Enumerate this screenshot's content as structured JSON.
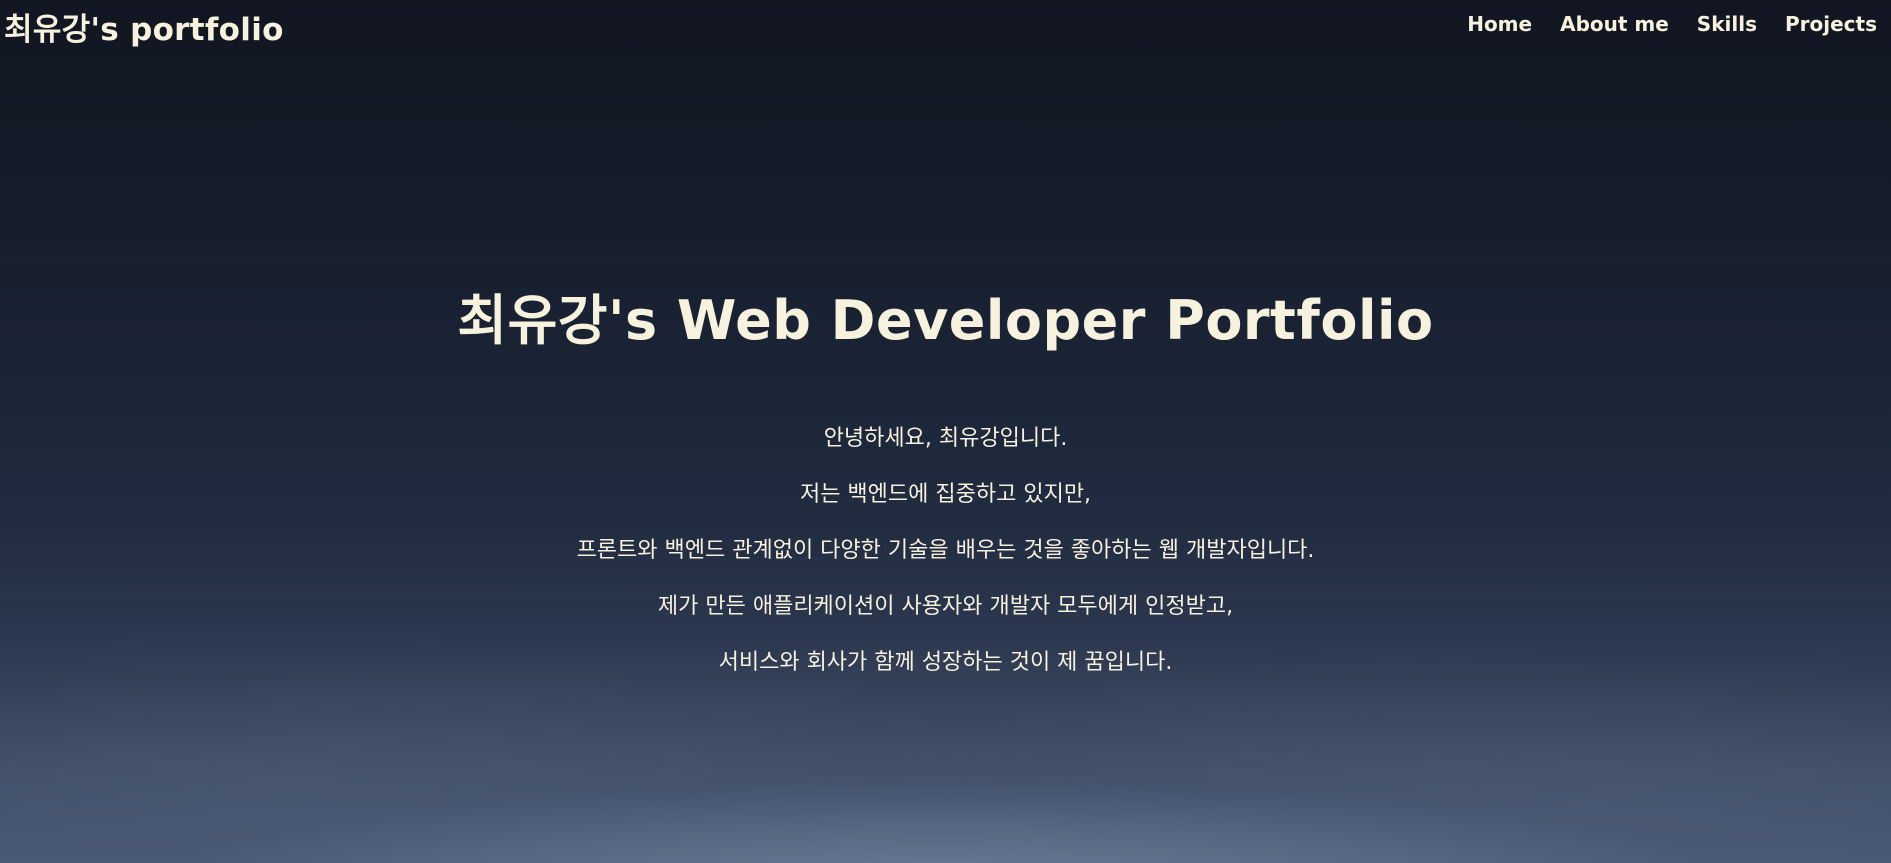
{
  "header": {
    "brand": "최유강's portfolio",
    "nav": [
      {
        "label": "Home"
      },
      {
        "label": "About me"
      },
      {
        "label": "Skills"
      },
      {
        "label": "Projects"
      }
    ]
  },
  "hero": {
    "title": "최유강's Web Developer Portfolio",
    "intro_lines": [
      "안녕하세요, 최유강입니다.",
      "저는 백엔드에 집중하고 있지만,",
      "프론트와 백엔드 관계없이 다양한 기술을 배우는 것을 좋아하는 웹 개발자입니다.",
      "제가 만든 애플리케이션이 사용자와 개발자 모두에게 인정받고,",
      "서비스와 회사가 함께 성장하는 것이 제 꿈입니다."
    ]
  },
  "colors": {
    "text": "#f7f2de",
    "background_top": "#111621",
    "background_bottom": "#4a5a75"
  }
}
